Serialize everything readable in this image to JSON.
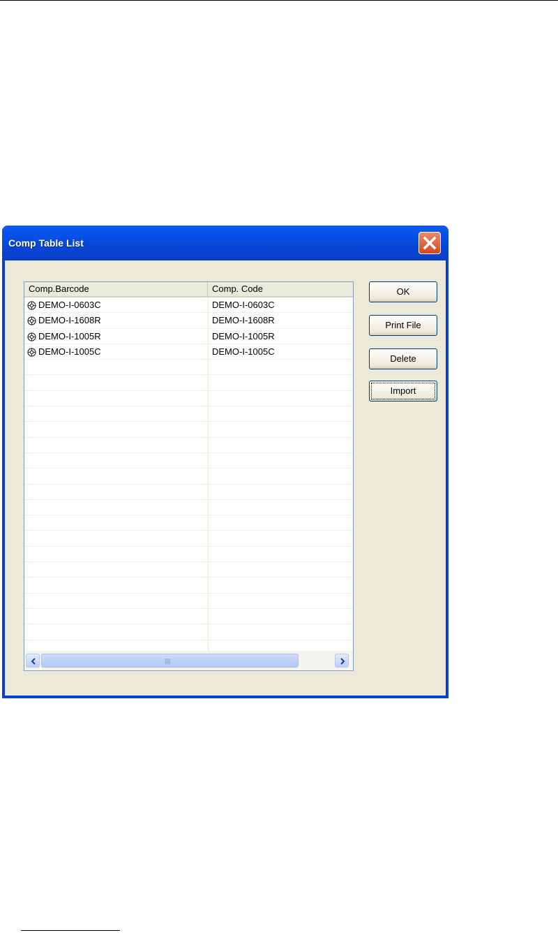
{
  "window": {
    "title": "Comp Table List"
  },
  "table": {
    "columns": [
      "Comp.Barcode",
      "Comp. Code"
    ],
    "rows": [
      {
        "barcode": "DEMO-I-0603C",
        "code": "DEMO-I-0603C"
      },
      {
        "barcode": "DEMO-I-1608R",
        "code": "DEMO-I-1608R"
      },
      {
        "barcode": "DEMO-I-1005R",
        "code": "DEMO-I-1005R"
      },
      {
        "barcode": "DEMO-I-1005C",
        "code": "DEMO-I-1005C"
      }
    ]
  },
  "buttons": {
    "ok": "OK",
    "print_file": "Print File",
    "delete": "Delete",
    "import": "Import"
  },
  "icons": {
    "close": "close-icon",
    "row": "reel-icon",
    "scroll_left": "chevron-left-icon",
    "scroll_right": "chevron-right-icon"
  }
}
